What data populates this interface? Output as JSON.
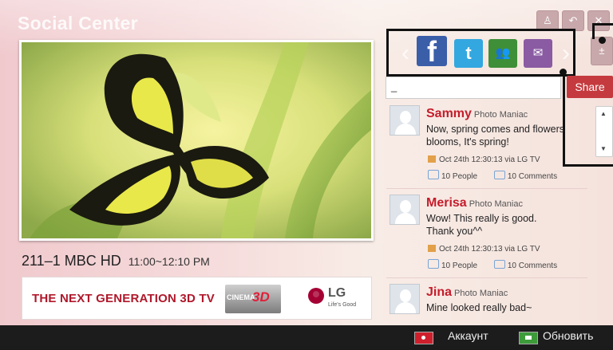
{
  "app": {
    "title": "Social Center"
  },
  "tv": {
    "channel_name": "211–1 MBC HD",
    "channel_time": "11:00~12:10 PM"
  },
  "ad": {
    "headline": "THE NEXT GENERATION 3D TV",
    "cinema_label": "CINEMA",
    "cinema_3d": "3D",
    "brand": "LG",
    "brand_tagline": "Life's Good"
  },
  "social_nav": {
    "prev_icon": "chevron-left-icon",
    "next_icon": "chevron-right-icon",
    "networks": [
      {
        "name": "facebook-icon",
        "glyph": "f"
      },
      {
        "name": "twitter-icon",
        "glyph": "t"
      },
      {
        "name": "friends-icon",
        "glyph": "👥"
      },
      {
        "name": "messages-icon",
        "glyph": "✉"
      }
    ]
  },
  "share": {
    "input_value": "_",
    "button_label": "Share"
  },
  "posts": [
    {
      "author": "Sammy",
      "tag": "Photo Maniac",
      "text": "Now, spring comes and flowers blooms, It's spring!",
      "meta": "Oct 24th 12:30:13 via LG TV",
      "likes": "10 People",
      "comments": "10 Comments"
    },
    {
      "author": "Merisa",
      "tag": "Photo Maniac",
      "text": "Wow! This really is good. Thank you^^",
      "meta": "Oct 24th 12:30:13 via LG TV",
      "likes": "10 People",
      "comments": "10 Comments"
    },
    {
      "author": "Jina",
      "tag": "Photo Maniac",
      "text": "Mine looked really bad~",
      "meta": "",
      "likes": "",
      "comments": ""
    }
  ],
  "bottom_bar": {
    "account_label": "Аккаунт",
    "refresh_label": "Обновить"
  },
  "colors": {
    "accent_red": "#c51c2b",
    "share_button": "#c53a3e",
    "facebook": "#3b5ea8",
    "twitter": "#33a7e0"
  }
}
